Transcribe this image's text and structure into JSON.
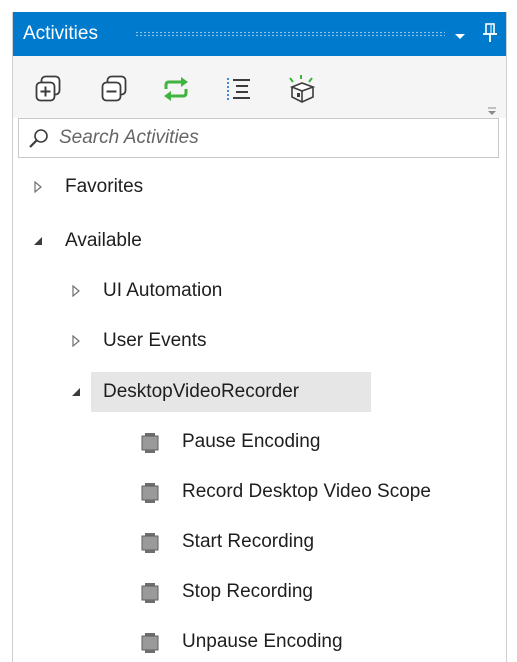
{
  "panel": {
    "title": "Activities",
    "search_placeholder": "Search Activities"
  },
  "toolbar": {
    "icons": [
      "expand-all-icon",
      "collapse-all-icon",
      "refresh-icon",
      "show-list-icon",
      "manage-packages-icon"
    ]
  },
  "colors": {
    "titlebar": "#007acc",
    "toolbar_bg": "#f5f5f5",
    "selected_row": "#e6e6e6",
    "refresh_green": "#3fb43f"
  },
  "tree": {
    "favorites": "Favorites",
    "available": "Available",
    "ui_automation": "UI Automation",
    "user_events": "User Events",
    "desktop_video_recorder": "DesktopVideoRecorder",
    "activities": [
      "Pause Encoding",
      "Record Desktop Video Scope",
      "Start Recording",
      "Stop Recording",
      "Unpause Encoding"
    ]
  }
}
